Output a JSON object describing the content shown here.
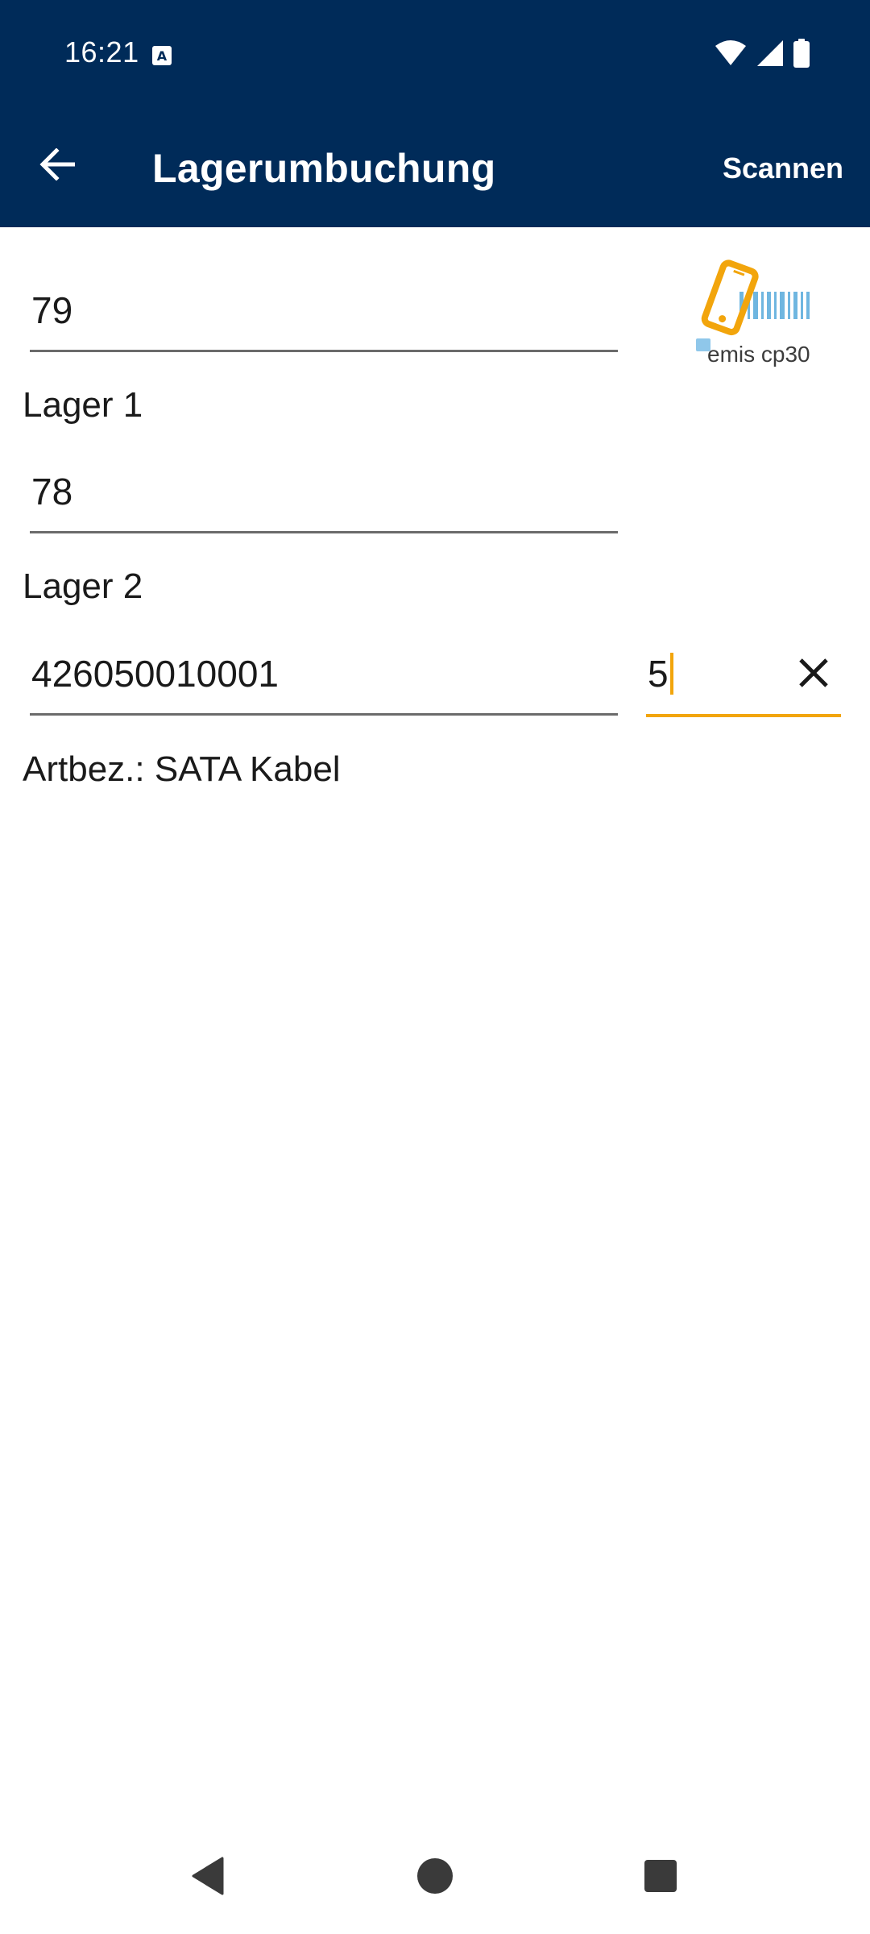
{
  "status_bar": {
    "time": "16:21",
    "icons": [
      "keyboard-a-icon",
      "wifi-icon",
      "signal-icon",
      "battery-icon"
    ]
  },
  "app_bar": {
    "title": "Lagerumbuchung",
    "scan_label": "Scannen",
    "back_icon": "arrow-left-icon"
  },
  "form": {
    "field1_value": "79",
    "lager1_label": "Lager 1",
    "field2_value": "78",
    "lager2_label": "Lager 2",
    "article_number": "426050010001",
    "quantity_value": "5",
    "article_description": "Artbez.: SATA Kabel"
  },
  "logo": {
    "text": "emis cp30",
    "icon": "phone-barcode-icon"
  },
  "nav_bar": {
    "icons": [
      "back-triangle-icon",
      "home-circle-icon",
      "recents-square-icon"
    ]
  },
  "colors": {
    "primary": "#002b59",
    "accent": "#f2a50c",
    "logo_blue": "#6fb6e0"
  }
}
